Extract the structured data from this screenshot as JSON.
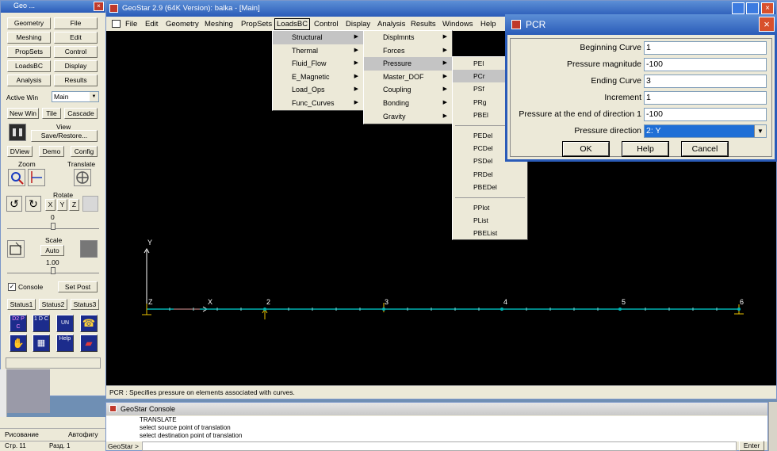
{
  "left_panel": {
    "title": "Geo ...",
    "buttons_row1": [
      "Geometry",
      "File"
    ],
    "buttons_row2": [
      "Meshing",
      "Edit"
    ],
    "buttons_row3": [
      "PropSets",
      "Control"
    ],
    "buttons_row4": [
      "LoadsBC",
      "Display"
    ],
    "buttons_row5": [
      "Analysis",
      "Results"
    ],
    "active_win_label": "Active Win",
    "active_win_value": "Main",
    "win_buttons": [
      "New Win",
      "Tile",
      "Cascade"
    ],
    "view_label": "View",
    "save_restore": "Save/Restore...",
    "row_dview": [
      "DView",
      "Demo",
      "Config"
    ],
    "zoom_label": "Zoom",
    "translate_label": "Translate",
    "rotate_label": "Rotate",
    "rotate_axes": [
      "X",
      "Y",
      "Z"
    ],
    "rotate_value": "0",
    "scale_label": "Scale",
    "scale_auto": "Auto",
    "scale_value": "1.00",
    "console_label": "Console",
    "set_post": "Set Post",
    "status_buttons": [
      "Status1",
      "Status2",
      "Status3"
    ],
    "icon_texts": [
      "D2 P C",
      "1 D C",
      "UN",
      "",
      "",
      "",
      "Help",
      ""
    ]
  },
  "main_window": {
    "title": "GeoStar 2.9 (64K Version): balka - [Main]",
    "menu": [
      "File",
      "Edit",
      "Geometry",
      "Meshing",
      "PropSets",
      "LoadsBC",
      "Control",
      "Display",
      "Analysis",
      "Results",
      "Windows",
      "Help"
    ],
    "status_text": "PCR : Specifies pressure on elements associated with curves."
  },
  "loadsbc_menu": [
    "Structural",
    "Thermal",
    "Fluid_Flow",
    "E_Magnetic",
    "Load_Ops",
    "Func_Curves"
  ],
  "structural_menu": [
    "Displmnts",
    "Forces",
    "Pressure",
    "Master_DOF",
    "Coupling",
    "Bonding",
    "Gravity"
  ],
  "pressure_menu": [
    "PEl",
    "PCr",
    "PSf",
    "PRg",
    "PBEl",
    "PEDel",
    "PCDel",
    "PSDel",
    "PRDel",
    "PBEDel",
    "PPlot",
    "PList",
    "PBEList"
  ],
  "viewport": {
    "axis_y": "Y",
    "axis_x": "X",
    "axis_z": "Z",
    "nodes": [
      "2",
      "3",
      "4",
      "5",
      "6"
    ]
  },
  "dialog": {
    "title": "PCR",
    "fields": [
      {
        "label": "Beginning Curve",
        "value": "1"
      },
      {
        "label": "Pressure magnitude",
        "value": "-100"
      },
      {
        "label": "Ending Curve",
        "value": "3"
      },
      {
        "label": "Increment",
        "value": "1"
      },
      {
        "label": "Pressure at the end of direction 1",
        "value": "-100"
      }
    ],
    "direction_label": "Pressure direction",
    "direction_value": "2: Y",
    "ok": "OK",
    "help": "Help",
    "cancel": "Cancel"
  },
  "console": {
    "title": "GeoStar Console",
    "lines": [
      "TRANSLATE",
      "select source point of translation",
      "select destination point of translation"
    ],
    "prompt": "GeoStar >",
    "enter": "Enter"
  },
  "word_bar": {
    "drawing": "Рисование",
    "autoshapes": "Автофигу",
    "page": "Стр. 11",
    "section": "Разд. 1"
  },
  "colors": {
    "titlebar": "#2a5bb8",
    "viewport_bg": "#000000",
    "beam": "#00b3b3",
    "selection": "#1f6fd6"
  }
}
